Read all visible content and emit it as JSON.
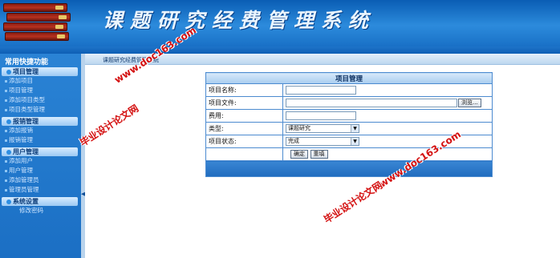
{
  "app": {
    "title": "课题研究经费管理系统"
  },
  "breadcrumb": "课题研究经费管理系统",
  "sidebar": {
    "title": "常用快捷功能",
    "groups": [
      {
        "label": "项目管理",
        "items": [
          "添加项目",
          "项目管理",
          "添加项目类型",
          "项目类型管理"
        ]
      },
      {
        "label": "报销管理",
        "items": [
          "添加报销",
          "报销管理"
        ]
      },
      {
        "label": "用户管理",
        "items": [
          "添加用户",
          "用户管理",
          "添加管理员",
          "管理员管理"
        ]
      },
      {
        "label": "系统设置",
        "items": [
          "修改密码"
        ]
      }
    ]
  },
  "form": {
    "title": "项目管理",
    "name_label": "项目名称:",
    "name_value": "",
    "file_label": "项目文件:",
    "file_value": "",
    "browse_label": "浏览...",
    "fee_label": "费用:",
    "fee_value": "",
    "type_label": "类型:",
    "type_value": "课题研究",
    "status_label": "项目状态:",
    "status_value": "完成",
    "ok_label": "确定",
    "reset_label": "重填"
  },
  "watermarks": {
    "text_cn": "毕业设计论文网",
    "text_url": "www.doc163.com"
  },
  "colors": {
    "banner": "#1f78cf",
    "accent": "#4c8bd0",
    "watermark": "#d41010"
  }
}
